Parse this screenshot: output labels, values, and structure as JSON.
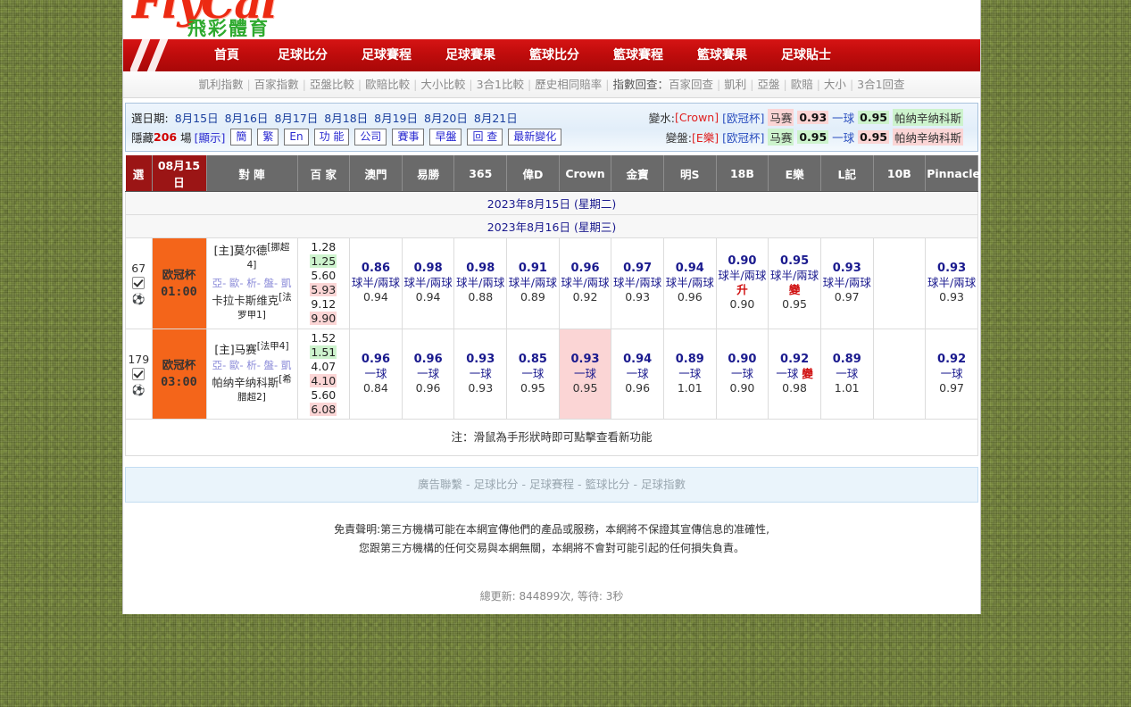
{
  "logo": {
    "main": "FlyCai",
    "sub": "飛彩體育"
  },
  "nav": {
    "items": [
      {
        "label": "首頁"
      },
      {
        "label": "足球比分"
      },
      {
        "label": "足球賽程"
      },
      {
        "label": "足球賽果"
      },
      {
        "label": "籃球比分"
      },
      {
        "label": "籃球賽程"
      },
      {
        "label": "籃球賽果"
      },
      {
        "label": "足球貼士"
      }
    ]
  },
  "subnav": {
    "items": [
      "凱利指數",
      "百家指數",
      "亞盤比較",
      "歐賠比較",
      "大小比較",
      "3合1比較",
      "歷史相同賠率"
    ],
    "group_label": "指數回查：",
    "group_items": [
      "百家回查",
      "凱利",
      "亞盤",
      "歐賠",
      "大小",
      "3合1回查"
    ]
  },
  "panel": {
    "date_label": "選日期:",
    "dates": [
      "8月15日",
      "8月16日",
      "8月17日",
      "8月18日",
      "8月19日",
      "8月20日",
      "8月21日"
    ],
    "hide_prefix": "隱藏",
    "hide_count": "206",
    "hide_suffix": "場",
    "show_link": "[顯示]",
    "buttons": [
      "簡",
      "繁",
      "En",
      "功 能",
      "公司",
      "賽事",
      "早盤",
      "回 查",
      "最新變化"
    ],
    "change_water": {
      "label": "變水:",
      "book": "[Crown]",
      "league": "[欧冠杯]",
      "home": "马赛",
      "home_odd": "0.93",
      "handicap": "一球",
      "away_odd": "0.95",
      "away": "帕纳辛纳科斯"
    },
    "change_line": {
      "label": "變盤:",
      "book": "[E樂]",
      "league": "[欧冠杯]",
      "home": "马赛",
      "home_odd": "0.95",
      "handicap": "一球",
      "away_odd": "0.95",
      "away": "帕纳辛纳科斯"
    }
  },
  "table": {
    "headers": [
      "選",
      "08月15日",
      "對 陣",
      "百 家",
      "澳門",
      "易勝",
      "365",
      "偉D",
      "Crown",
      "金寶",
      "明S",
      "18B",
      "E樂",
      "L記",
      "10B",
      "Pinnacle"
    ],
    "date_rows": [
      "2023年8月15日 (星期二)",
      "2023年8月16日 (星期三)"
    ],
    "rows": [
      {
        "num": "67",
        "league": "欧冠杯",
        "time": "01:00",
        "home": "[主]莫尔德",
        "home_rank": "[挪超4]",
        "away": "卡拉卡斯维克",
        "away_rank": "[法罗甲1]",
        "links": "亞- 歐- 析- 盤- 凱",
        "bai": [
          {
            "left": "1.28",
            "right": "1.25",
            "right_hl": "g"
          },
          {
            "left": "5.60",
            "right": "5.93",
            "right_hl": "p"
          },
          {
            "left": "9.12",
            "right": "9.90",
            "right_hl": "p"
          }
        ],
        "odds": [
          {
            "top": "0.86",
            "mid": "球半/兩球",
            "bot": "0.94",
            "flag": "",
            "hot": false
          },
          {
            "top": "0.98",
            "mid": "球半/兩球",
            "bot": "0.94",
            "flag": "",
            "hot": false
          },
          {
            "top": "0.98",
            "mid": "球半/兩球",
            "bot": "0.88",
            "flag": "",
            "hot": false
          },
          {
            "top": "0.91",
            "mid": "球半/兩球",
            "bot": "0.89",
            "flag": "",
            "hot": false
          },
          {
            "top": "0.96",
            "mid": "球半/兩球",
            "bot": "0.92",
            "flag": "",
            "hot": false
          },
          {
            "top": "0.97",
            "mid": "球半/兩球",
            "bot": "0.93",
            "flag": "",
            "hot": false
          },
          {
            "top": "0.94",
            "mid": "球半/兩球",
            "bot": "0.96",
            "flag": "",
            "hot": false
          },
          {
            "top": "0.90",
            "mid": "球半/兩球",
            "bot": "0.90",
            "flag": "升",
            "hot": false
          },
          {
            "top": "0.95",
            "mid": "球半/兩球",
            "bot": "0.95",
            "flag": "變",
            "hot": false
          },
          {
            "top": "0.93",
            "mid": "球半/兩球",
            "bot": "0.97",
            "flag": "",
            "hot": false
          },
          {
            "top": "",
            "mid": "",
            "bot": "",
            "flag": "",
            "hot": false
          },
          {
            "top": "0.93",
            "mid": "球半/兩球",
            "bot": "0.93",
            "flag": "",
            "hot": false
          }
        ]
      },
      {
        "num": "179",
        "league": "欧冠杯",
        "time": "03:00",
        "home": "[主]马赛",
        "home_rank": "[法甲4]",
        "away": "帕纳辛纳科斯",
        "away_rank": "[希腊超2]",
        "links": "亞- 歐- 析- 盤- 凱",
        "bai": [
          {
            "left": "1.52",
            "right": "1.51",
            "right_hl": "g"
          },
          {
            "left": "4.07",
            "right": "4.10",
            "right_hl": "p"
          },
          {
            "left": "5.60",
            "right": "6.08",
            "right_hl": "p"
          }
        ],
        "odds": [
          {
            "top": "0.96",
            "mid": "一球",
            "bot": "0.84",
            "flag": "",
            "hot": false
          },
          {
            "top": "0.96",
            "mid": "一球",
            "bot": "0.96",
            "flag": "",
            "hot": false
          },
          {
            "top": "0.93",
            "mid": "一球",
            "bot": "0.93",
            "flag": "",
            "hot": false
          },
          {
            "top": "0.85",
            "mid": "一球",
            "bot": "0.95",
            "flag": "",
            "hot": false
          },
          {
            "top": "0.93",
            "mid": "一球",
            "bot": "0.95",
            "flag": "",
            "hot": true
          },
          {
            "top": "0.94",
            "mid": "一球",
            "bot": "0.96",
            "flag": "",
            "hot": false
          },
          {
            "top": "0.89",
            "mid": "一球",
            "bot": "1.01",
            "flag": "",
            "hot": false
          },
          {
            "top": "0.90",
            "mid": "一球",
            "bot": "0.90",
            "flag": "",
            "hot": false
          },
          {
            "top": "0.92",
            "mid": "一球",
            "bot": "0.98",
            "flag": "變",
            "hot": false
          },
          {
            "top": "0.89",
            "mid": "一球",
            "bot": "1.01",
            "flag": "",
            "hot": false
          },
          {
            "top": "",
            "mid": "",
            "bot": "",
            "flag": "",
            "hot": false
          },
          {
            "top": "0.92",
            "mid": "一球",
            "bot": "0.97",
            "flag": "",
            "hot": false
          }
        ]
      }
    ]
  },
  "note": "注：滑鼠為手形狀時即可點擊查看新功能",
  "adbar": {
    "items": [
      "廣告聯繫",
      "足球比分",
      "足球賽程",
      "籃球比分",
      "足球指數"
    ]
  },
  "disclaimer": {
    "line1": "免責聲明:第三方機構可能在本網宣傳他們的產品或服務，本網將不保證其宣傳信息的准確性,",
    "line2": "您跟第三方機構的任何交易與本網無關，本網將不會對可能引起的任何損失負責。"
  },
  "totals": "總更新: 844899次, 等待: 3秒"
}
